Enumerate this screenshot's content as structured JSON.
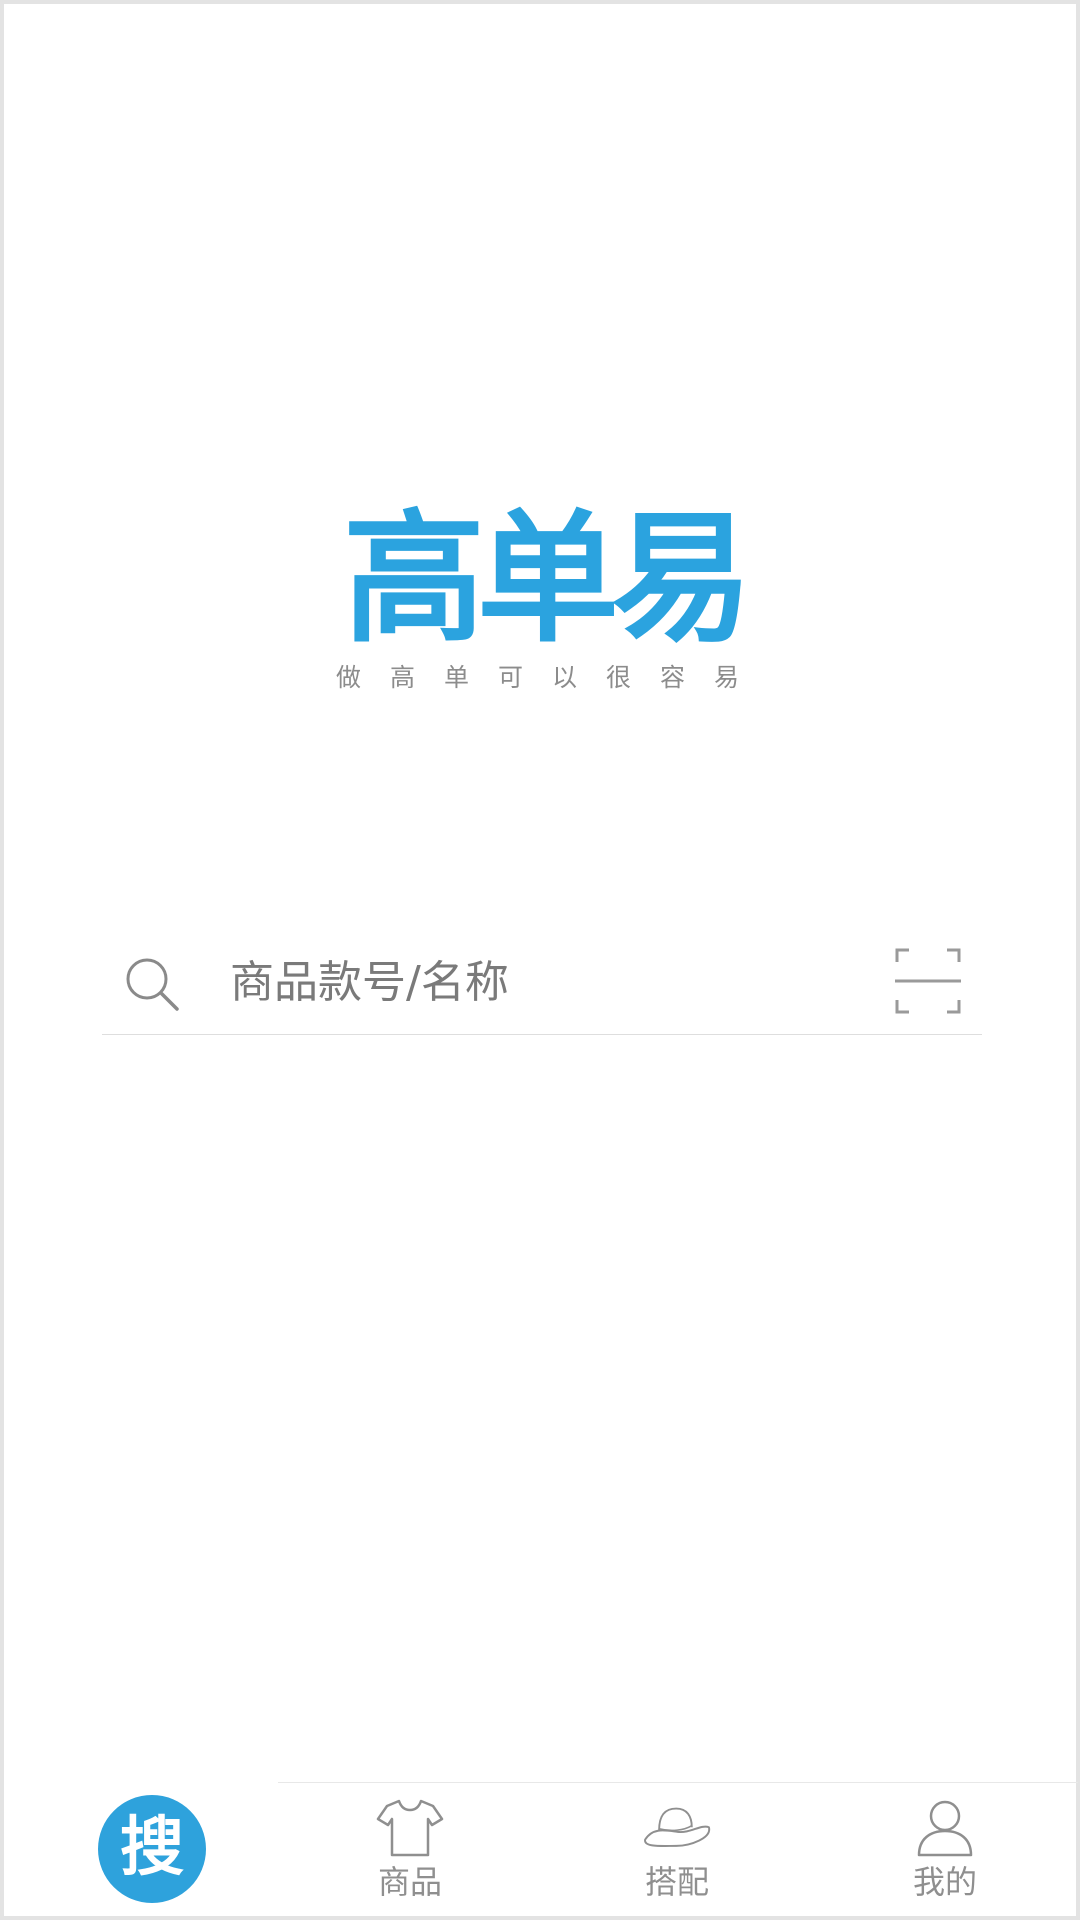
{
  "logo": {
    "title": "高单易",
    "slogan": "做高单可以很容易",
    "color": "#2ba3df"
  },
  "search": {
    "placeholder": "商品款号/名称",
    "value": "",
    "icon": "search-icon",
    "scan_icon": "scan-icon"
  },
  "tabbar": {
    "search_button_label": "搜",
    "accent_color": "#2ea2dc",
    "tabs": [
      {
        "label": "商品",
        "icon": "tshirt-icon"
      },
      {
        "label": "搭配",
        "icon": "hat-icon"
      },
      {
        "label": "我的",
        "icon": "person-icon"
      }
    ]
  }
}
